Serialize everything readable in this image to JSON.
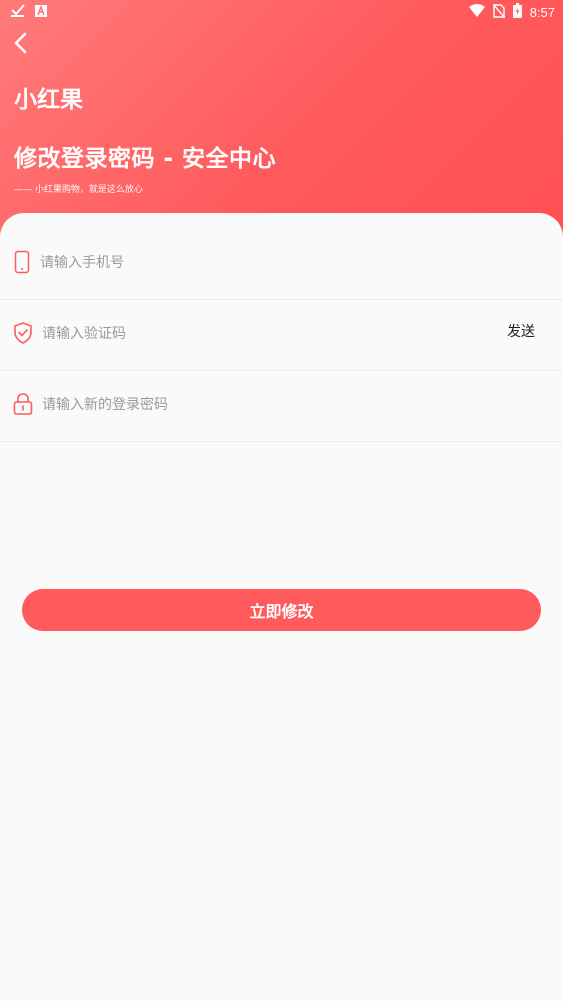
{
  "status_bar": {
    "time": "8:57",
    "icons": [
      "check-icon",
      "app-a-icon",
      "wifi-icon",
      "no-sim-icon",
      "battery-icon"
    ]
  },
  "header": {
    "brand": "小红果",
    "title": "修改登录密码 - 安全中心",
    "slogan": "—— 小红果购物，就是这么放心"
  },
  "form": {
    "phone_placeholder": "请输入手机号",
    "code_placeholder": "请输入验证码",
    "send_label": "发送",
    "password_placeholder": "请输入新的登录密码",
    "submit_label": "立即修改"
  },
  "colors": {
    "accent": "#ff5a5c",
    "header_start": "#ff7a7a",
    "header_end": "#ff4f55"
  }
}
